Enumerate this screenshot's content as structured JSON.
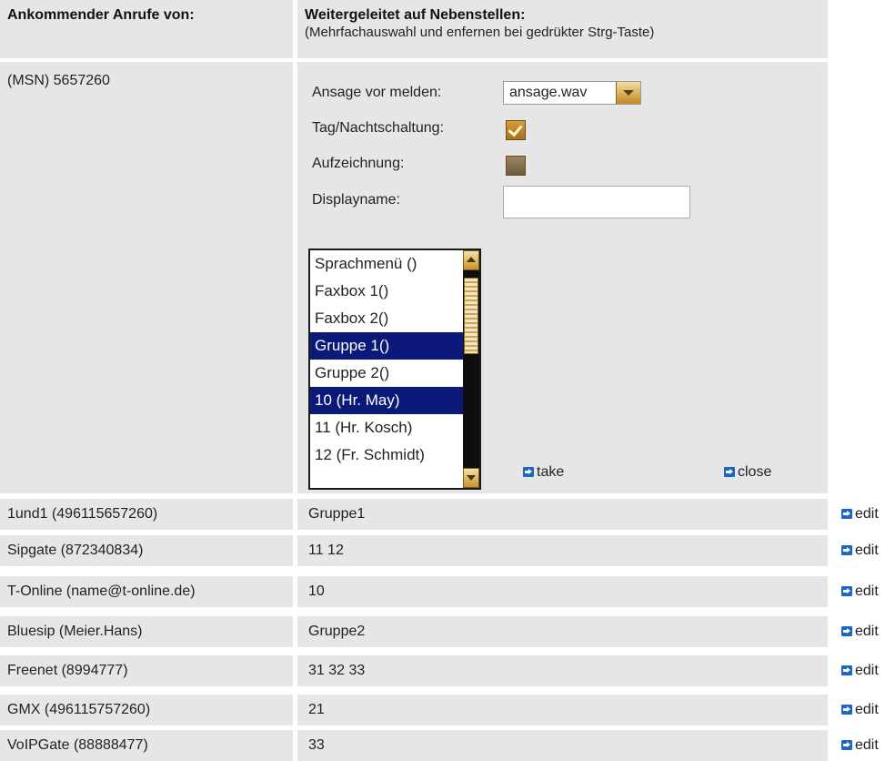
{
  "header": {
    "left_title": "Ankommender Anrufe von:",
    "right_title": "Weitergeleitet auf Nebenstellen:",
    "right_subtitle": "(Mehrfachauswahl und enfernen bei gedrükter Strg-Taste)"
  },
  "msn": {
    "label": "(MSN) 5657260",
    "announcement_label": "Ansage vor melden:",
    "announcement_value": "ansage.wav",
    "daynight_label": "Tag/Nachtschaltung:",
    "daynight_checked": true,
    "recording_label": "Aufzeichnung:",
    "recording_checked": false,
    "displayname_label": "Displayname:",
    "displayname_value": "",
    "options": [
      {
        "label": "Sprachmenü ()",
        "selected": false
      },
      {
        "label": "Faxbox 1()",
        "selected": false
      },
      {
        "label": "Faxbox 2()",
        "selected": false
      },
      {
        "label": "Gruppe 1()",
        "selected": true
      },
      {
        "label": "Gruppe 2()",
        "selected": false
      },
      {
        "label": "10 (Hr. May)",
        "selected": true
      },
      {
        "label": "11 (Hr. Kosch)",
        "selected": false
      },
      {
        "label": "12 (Fr. Schmidt)",
        "selected": false
      }
    ],
    "take_label": "take",
    "close_label": "close"
  },
  "rows": [
    {
      "source": "1und1 (496115657260)",
      "target": "Gruppe1",
      "action": "edit"
    },
    {
      "source": "Sipgate (872340834)",
      "target": "11  12",
      "action": "edit"
    },
    {
      "source": "T-Online (name@t-online.de)",
      "target": "10",
      "action": "edit"
    },
    {
      "source": "Bluesip (Meier.Hans)",
      "target": "Gruppe2",
      "action": "edit"
    },
    {
      "source": "Freenet (8994777)",
      "target": "31  32  33",
      "action": "edit"
    },
    {
      "source": "GMX (496115757260)",
      "target": "21",
      "action": "edit"
    },
    {
      "source": "VoIPGate (88888477)",
      "target": "33",
      "action": "edit"
    }
  ],
  "colors": {
    "cell_bg": "#e6e6e6",
    "selection_bg": "#0b1a7a",
    "accent_gold": "#c08a22",
    "link_arrow_blue": "#1b67c4"
  },
  "icons": {
    "link_arrow": "arrow-right-icon",
    "checkbox_checked": "checkmark-icon"
  }
}
